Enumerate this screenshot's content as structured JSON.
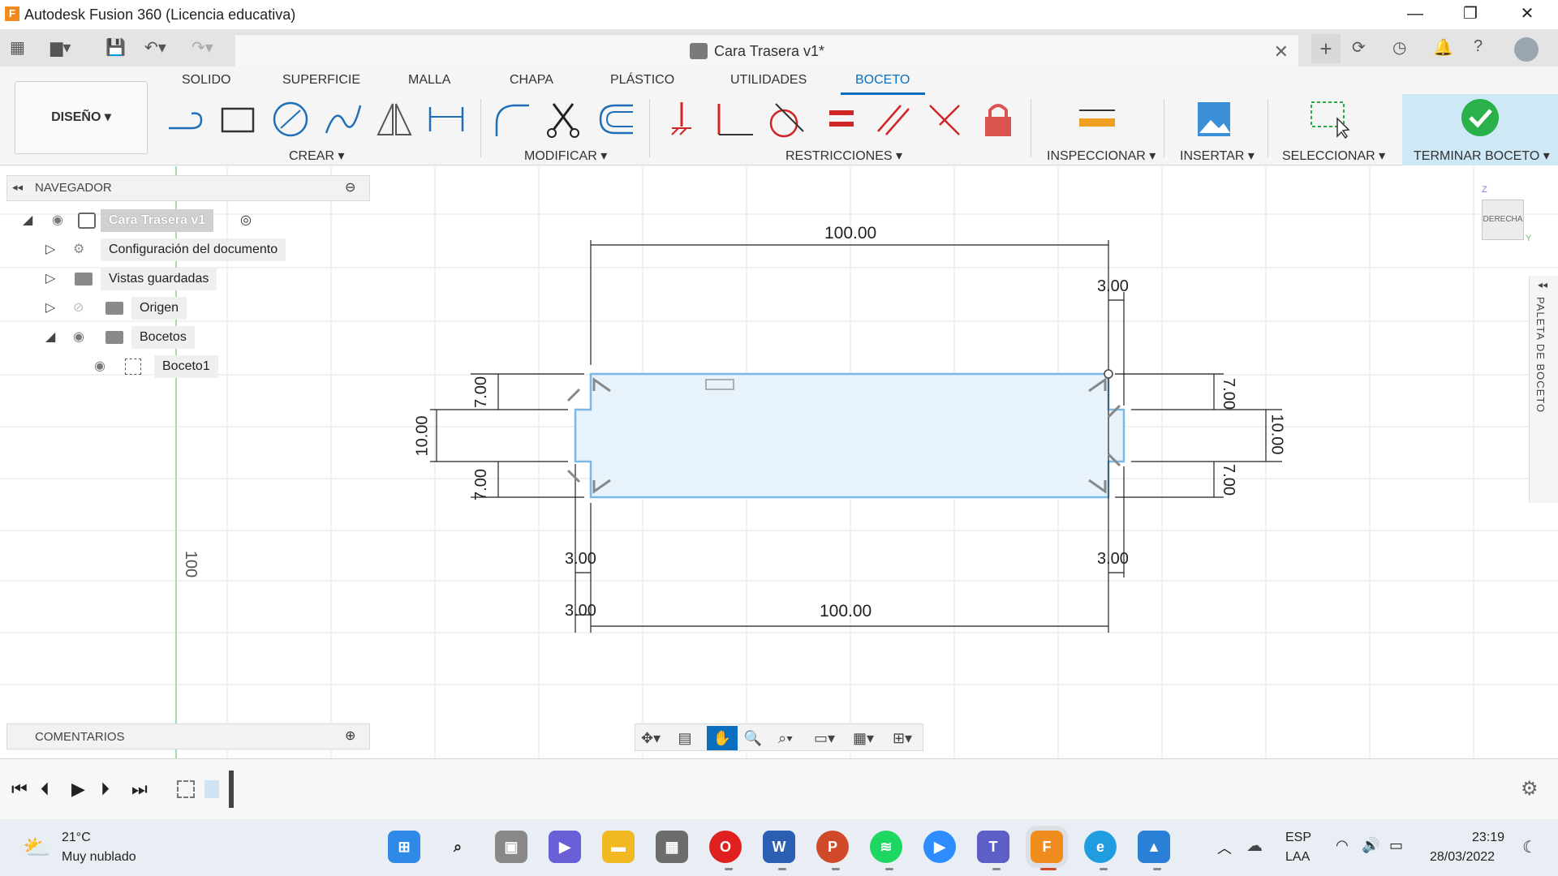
{
  "window": {
    "app_letter": "F",
    "title": "Autodesk Fusion 360 (Licencia educativa)",
    "minimize": "—",
    "restore": "❐",
    "close": "✕"
  },
  "document": {
    "title": "Cara Trasera v1*",
    "close": "✕"
  },
  "ribbon": {
    "tabs": [
      "SOLIDO",
      "SUPERFICIE",
      "MALLA",
      "CHAPA",
      "PLÁSTICO",
      "UTILIDADES",
      "BOCETO"
    ],
    "active_tab": "BOCETO",
    "workspace": "DISEÑO ▾",
    "groups": {
      "create": "CREAR ▾",
      "modify": "MODIFICAR ▾",
      "constraints": "RESTRICCIONES ▾",
      "inspect": "INSPECCIONAR ▾",
      "insert": "INSERTAR ▾",
      "select": "SELECCIONAR ▾",
      "finish": "TERMINAR BOCETO ▾"
    },
    "accent": "#0b6fbf"
  },
  "navigator": {
    "title": "NAVEGADOR",
    "items": [
      {
        "label": "Cara Trasera v1"
      },
      {
        "label": "Configuración del documento"
      },
      {
        "label": "Vistas guardadas"
      },
      {
        "label": "Origen"
      },
      {
        "label": "Bocetos"
      },
      {
        "label": "Boceto1"
      }
    ]
  },
  "comments": {
    "title": "COMENTARIOS"
  },
  "viewcube": {
    "face": "DERECHA",
    "axis_z": "Z",
    "axis_y": "Y"
  },
  "palette": {
    "label": "PALETA DE BOCETO"
  },
  "sketch": {
    "dim_top": "100.00",
    "dim_bottom": "100.00",
    "dim_3_right_top": "3.00",
    "dim_3_left_mid": "3.00",
    "dim_3_right_mid": "3.00",
    "dim_3_left_bottom": "3.00",
    "dim_left_7_top": "7.00",
    "dim_left_10": "10.00",
    "dim_left_7_bottom": "7.00",
    "dim_right_7_top": "7.00",
    "dim_right_10": "10.00",
    "dim_right_7_bottom": "7.00",
    "axis_label": "100"
  },
  "taskbar": {
    "temp": "21°C",
    "weather": "Muy nublado",
    "lang1": "ESP",
    "lang2": "LAA",
    "time": "23:19",
    "date": "28/03/2022"
  }
}
